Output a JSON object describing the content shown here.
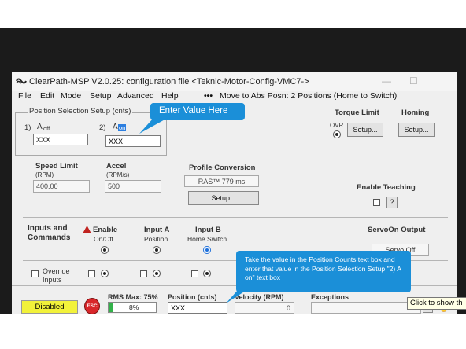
{
  "window": {
    "title": "ClearPath-MSP V2.0.25:  configuration file <Teknic-Motor-Config-VMC7->",
    "minimize": "—",
    "maximize": "☐"
  },
  "menu": {
    "items": [
      "File",
      "Edit",
      "Mode",
      "Setup",
      "Advanced",
      "Help"
    ],
    "move_status": "Move to Abs Posn: 2 Positions (Home to Switch)"
  },
  "position_setup": {
    "title": "Position Selection Setup (cnts)",
    "a_off_num": "1)",
    "a_off_letter": "A",
    "a_off_sub": "off",
    "a_off_value": "XXX",
    "a_on_num": "2)",
    "a_on_letter": "A",
    "a_on_sub": "on",
    "a_on_value": "XXX"
  },
  "torque": {
    "label": "Torque Limit",
    "ovr": "OVR",
    "setup": "Setup..."
  },
  "homing": {
    "label": "Homing",
    "setup": "Setup..."
  },
  "speed": {
    "label": "Speed Limit",
    "unit": "(RPM)",
    "value": "400.00"
  },
  "accel": {
    "label": "Accel",
    "unit": "(RPM/s)",
    "value": "500"
  },
  "profile": {
    "label": "Profile Conversion",
    "value": "RAS™ 779 ms",
    "setup": "Setup..."
  },
  "teaching": {
    "label": "Enable Teaching",
    "help": "?"
  },
  "inputs": {
    "label_line1": "Inputs and",
    "label_line2": "Commands",
    "enable_title": "Enable",
    "enable_sub": "On/Off",
    "input_a_title": "Input A",
    "input_a_sub": "Position",
    "input_b_title": "Input B",
    "input_b_sub": "Home Switch",
    "servo_title": "ServoOn Output",
    "servo_value": "Servo Off",
    "override_line1": "Override",
    "override_line2": "Inputs"
  },
  "status": {
    "state": "Disabled",
    "esc": "ESC",
    "rms_label": "RMS Max: 75%",
    "rms_value": "8%",
    "rms_fraction": 0.08,
    "position_label": "Position (cnts)",
    "position_value": "XXX",
    "velocity_label": "Velocity (RPM)",
    "velocity_value": "0",
    "exceptions_label": "Exceptions",
    "help": "?"
  },
  "tooltip": {
    "text": "Click to show th"
  },
  "callouts": {
    "enter_value": "Enter Value Here",
    "instruction": "Take the value in the Position Counts text box and enter that value in the Position Selection Setup \"2) A on\" text box"
  },
  "colors": {
    "disabled_bg": "#f2f23a",
    "esc_red": "#d8262a",
    "callout_blue": "#1b8fd8",
    "rms_bar": "#33b24a",
    "selected_blue": "#1e6fd9"
  }
}
